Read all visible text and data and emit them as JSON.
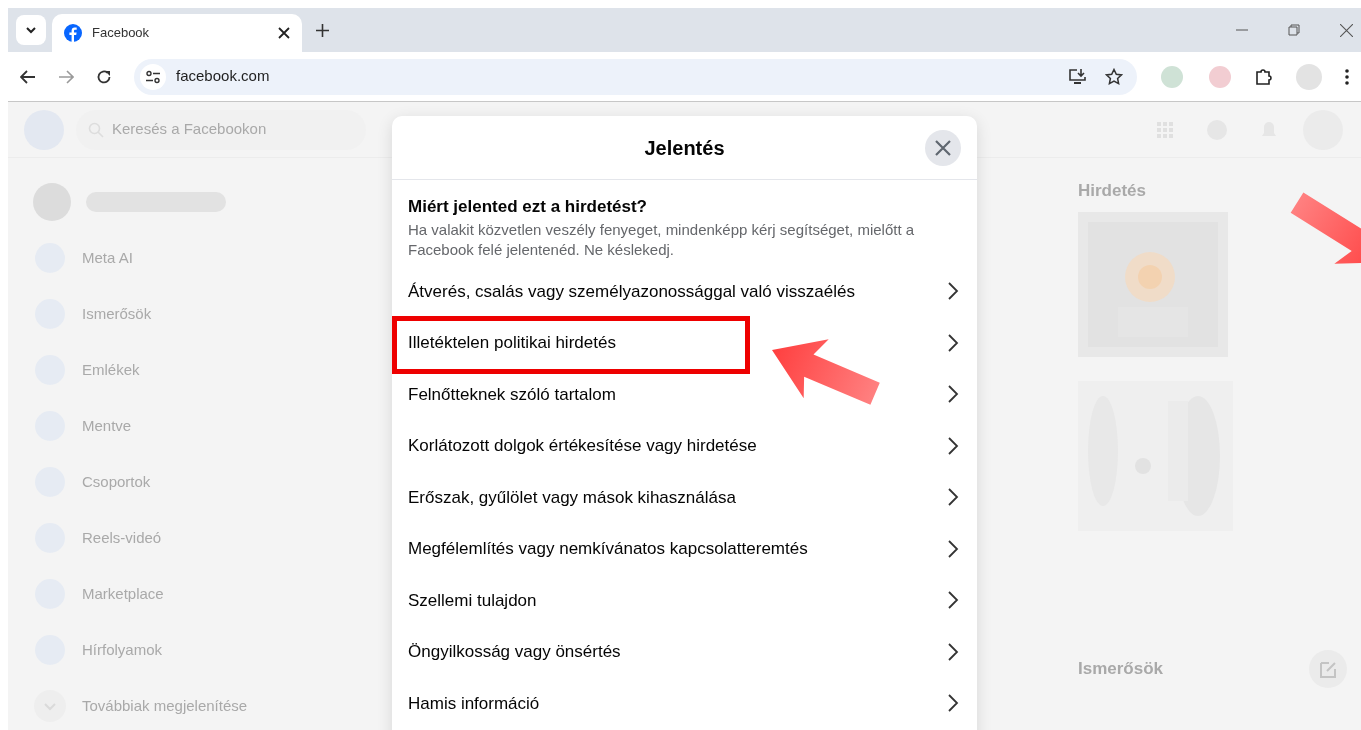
{
  "browser": {
    "tab": {
      "title": "Facebook"
    },
    "address": "facebook.com"
  },
  "page": {
    "search": {
      "placeholder": "Keresés a Facebookon"
    },
    "sidebar": [
      {
        "label": "Meta AI"
      },
      {
        "label": "Ismerősök"
      },
      {
        "label": "Emlékek"
      },
      {
        "label": "Mentve"
      },
      {
        "label": "Csoportok"
      },
      {
        "label": "Reels-videó"
      },
      {
        "label": "Marketplace"
      },
      {
        "label": "Hírfolyamok"
      }
    ],
    "sidebar_more": "Továbbiak megjelenítése",
    "ads_heading": "Hirdetés",
    "contacts_heading": "Ismerősök"
  },
  "dialog": {
    "title": "Jelentés",
    "question": "Miért jelented ezt a hirdetést?",
    "hint": "Ha valakit közvetlen veszély fenyeget, mindenképp kérj segítséget, mielőtt a Facebook felé jelentenéd. Ne késlekedj.",
    "options": [
      {
        "label": "Átverés, csalás vagy személyazonossággal való visszaélés",
        "highlighted": false
      },
      {
        "label": "Illetéktelen politikai hirdetés",
        "highlighted": true
      },
      {
        "label": "Felnőtteknek szóló tartalom",
        "highlighted": false
      },
      {
        "label": "Korlátozott dolgok értékesítése vagy hirdetése",
        "highlighted": false
      },
      {
        "label": "Erőszak, gyűlölet vagy mások kihasználása",
        "highlighted": false
      },
      {
        "label": "Megfélemlítés vagy nemkívánatos kapcsolatteremtés",
        "highlighted": false
      },
      {
        "label": "Szellemi tulajdon",
        "highlighted": false
      },
      {
        "label": "Öngyilkosság vagy önsértés",
        "highlighted": false
      },
      {
        "label": "Hamis információ",
        "highlighted": false
      }
    ]
  }
}
